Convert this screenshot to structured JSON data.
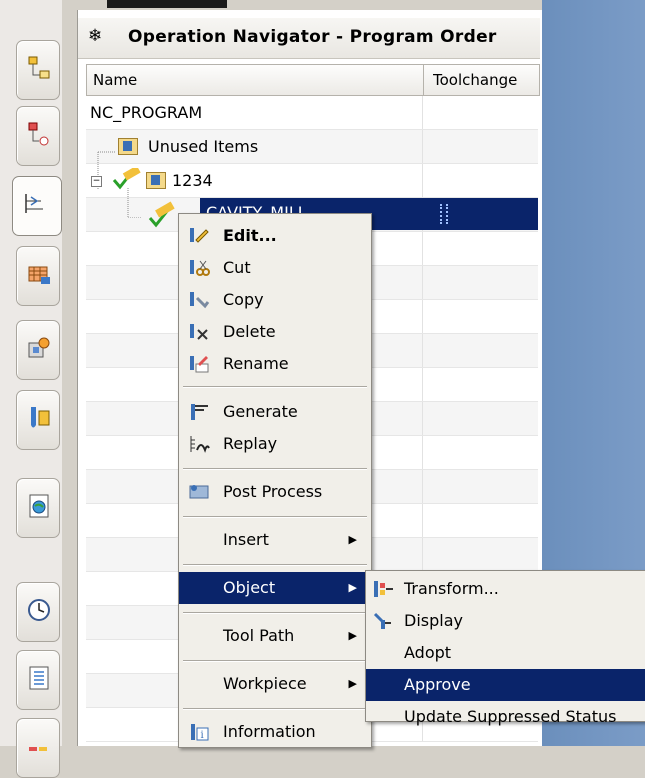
{
  "navigator": {
    "title": "Operation Navigator - Program Order",
    "columns": [
      "Name",
      "Toolchange"
    ],
    "tree": {
      "root": "NC_PROGRAM",
      "unused": "Unused Items",
      "program": "1234",
      "selected_op": "CAVITY_MILL"
    }
  },
  "context_menu": {
    "items": [
      {
        "label": "Edit...",
        "icon": "edit-icon",
        "bold": true
      },
      {
        "label": "Cut",
        "icon": "cut-icon"
      },
      {
        "label": "Copy",
        "icon": "copy-icon"
      },
      {
        "label": "Delete",
        "icon": "delete-icon"
      },
      {
        "label": "Rename",
        "icon": "rename-icon"
      },
      {
        "label": "Generate",
        "icon": "generate-icon"
      },
      {
        "label": "Replay",
        "icon": "replay-icon"
      },
      {
        "label": "Post Process",
        "icon": "post-process-icon"
      },
      {
        "label": "Insert",
        "submenu": true
      },
      {
        "label": "Object",
        "submenu": true,
        "highlighted": true
      },
      {
        "label": "Tool Path",
        "submenu": true
      },
      {
        "label": "Workpiece",
        "submenu": true
      },
      {
        "label": "Information",
        "icon": "information-icon"
      }
    ]
  },
  "object_submenu": {
    "items": [
      {
        "label": "Transform...",
        "icon": "transform-icon"
      },
      {
        "label": "Display",
        "icon": "display-icon"
      },
      {
        "label": "Adopt"
      },
      {
        "label": "Approve",
        "highlighted": true
      },
      {
        "label": "Update Suppressed Status"
      }
    ]
  },
  "colors": {
    "selection": "#0a246a",
    "menu_bg": "#f1efe9",
    "right_background": "#7b9cc7"
  }
}
